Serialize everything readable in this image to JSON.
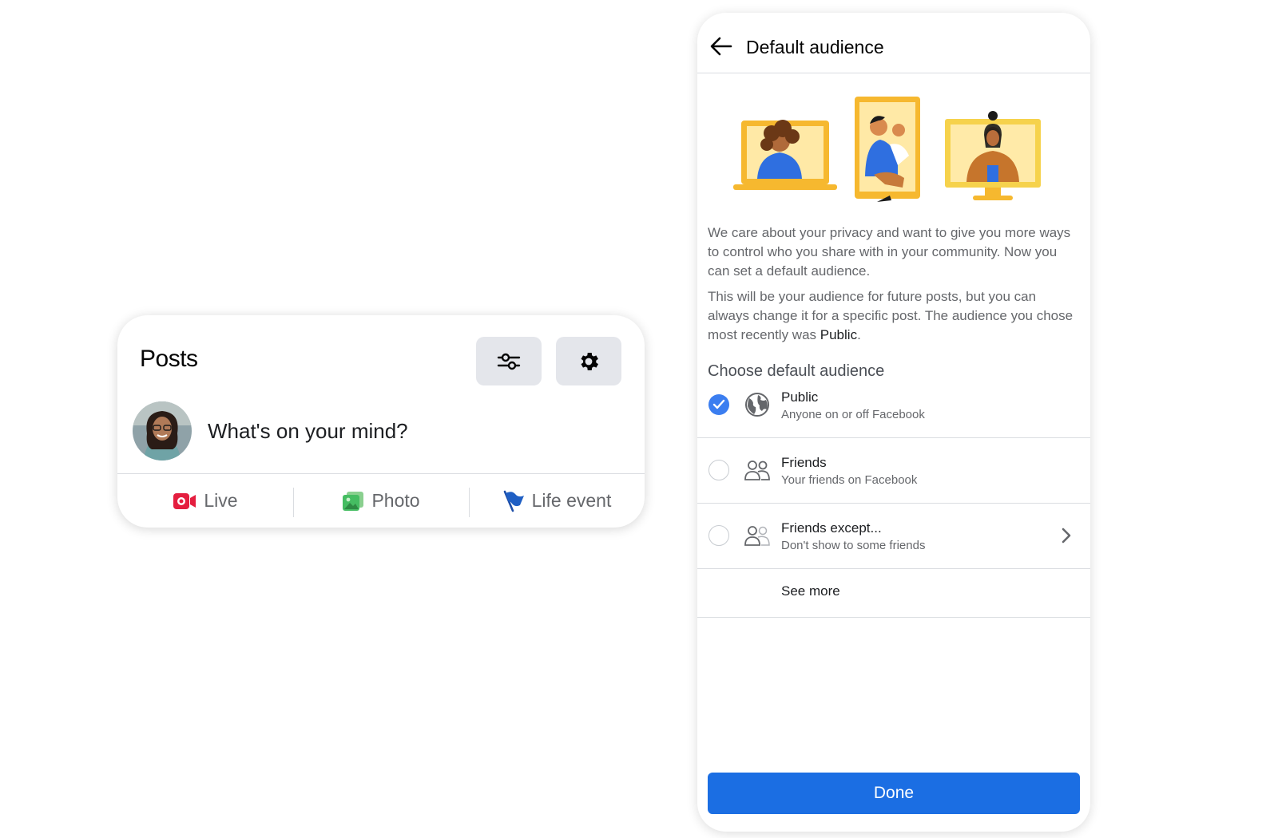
{
  "posts_card": {
    "title": "Posts",
    "composer_prompt": "What's on your mind?",
    "actions": [
      {
        "label": "Live",
        "icon": "live-video-icon",
        "color": "#e41e3f"
      },
      {
        "label": "Photo",
        "icon": "photo-icon",
        "color": "#45bd62"
      },
      {
        "label": "Life event",
        "icon": "flag-icon",
        "color": "#1877f2"
      }
    ],
    "buttons": [
      {
        "icon": "filter-sliders-icon"
      },
      {
        "icon": "gear-icon"
      }
    ]
  },
  "audience_panel": {
    "title": "Default audience",
    "description_1": "We care about your privacy and want to give you more ways to control who you share with in your community. Now you can set a default audience.",
    "description_2_prefix": "This will be your audience for future posts, but you can always change it for a specific post. The audience you chose most recently was ",
    "description_2_bold": "Public",
    "description_2_suffix": ".",
    "section_title": "Choose default audience",
    "options": [
      {
        "label": "Public",
        "sublabel": "Anyone on or off Facebook",
        "icon": "globe-icon",
        "selected": true
      },
      {
        "label": "Friends",
        "sublabel": "Your friends on Facebook",
        "icon": "friends-icon",
        "selected": false
      },
      {
        "label": "Friends except...",
        "sublabel": "Don't show to some friends",
        "icon": "friends-except-icon",
        "selected": false
      }
    ],
    "see_more": "See more",
    "done": "Done",
    "accent_color": "#1b6ee3"
  }
}
